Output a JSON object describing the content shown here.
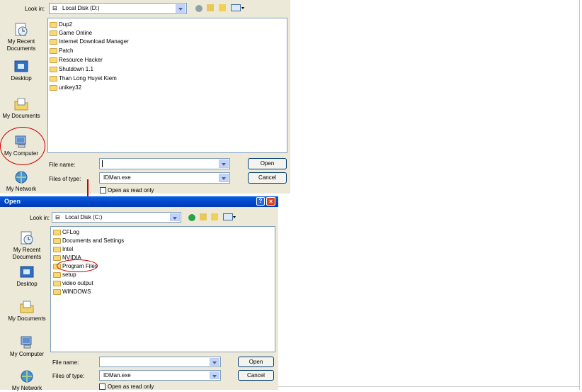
{
  "top_dialog": {
    "look_in_label": "Look in:",
    "look_in_value": "Local Disk (D:)",
    "places": [
      {
        "label": "My Recent\nDocuments",
        "icon": "recent-documents-icon"
      },
      {
        "label": "Desktop",
        "icon": "desktop-icon"
      },
      {
        "label": "My Documents",
        "icon": "my-documents-icon"
      },
      {
        "label": "My Computer",
        "icon": "my-computer-icon"
      },
      {
        "label": "My Network",
        "icon": "my-network-icon"
      }
    ],
    "files": [
      "Dup2",
      "Game Online",
      "Internet Download Manager",
      "Patch",
      "Resource Hacker",
      "Shutdown 1.1",
      "Than Long Huyet Kiem",
      "unikey32"
    ],
    "file_name_label": "File name:",
    "file_name_value": "",
    "files_of_type_label": "Files of type:",
    "files_of_type_value": "IDMan.exe",
    "open_label": "Open",
    "cancel_label": "Cancel",
    "readonly_label": "Open as read only"
  },
  "bottom_dialog": {
    "title": "Open",
    "look_in_label": "Look in:",
    "look_in_value": "Local Disk (C:)",
    "places": [
      {
        "label": "My Recent\nDocuments",
        "icon": "recent-documents-icon"
      },
      {
        "label": "Desktop",
        "icon": "desktop-icon"
      },
      {
        "label": "My Documents",
        "icon": "my-documents-icon"
      },
      {
        "label": "My Computer",
        "icon": "my-computer-icon"
      },
      {
        "label": "My Network",
        "icon": "my-network-icon"
      }
    ],
    "files": [
      "CFLog",
      "Documents and Settings",
      "Intel",
      "NVIDIA",
      "Program Files",
      "setup",
      "video output",
      "WINDOWS"
    ],
    "file_name_label": "File name:",
    "file_name_value": "",
    "files_of_type_label": "Files of type:",
    "files_of_type_value": "IDMan.exe",
    "open_label": "Open",
    "cancel_label": "Cancel",
    "readonly_label": "Open as read only"
  },
  "colors": {
    "annotation": "#cc0000",
    "xp_title": "#0044c8",
    "dialog_bg": "#ece9d8"
  }
}
